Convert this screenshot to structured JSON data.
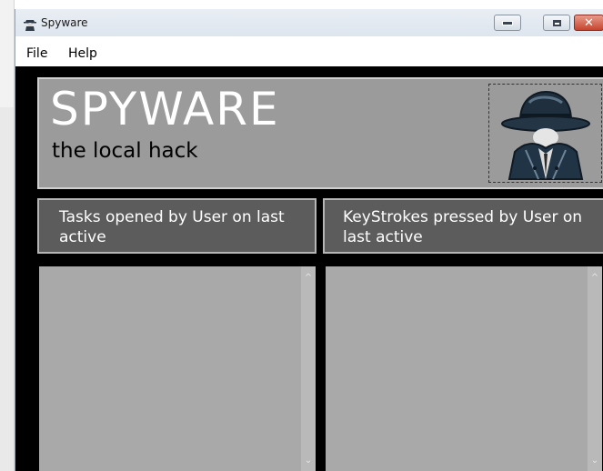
{
  "window": {
    "title": "Spyware",
    "close_glyph": "✕"
  },
  "menu": {
    "items": [
      {
        "label": "File"
      },
      {
        "label": "Help"
      }
    ]
  },
  "banner": {
    "title": "SPYWARE",
    "subtitle": "the local hack",
    "logo_icon": "spy-agent-icon"
  },
  "sections": {
    "tasks": {
      "header": "Tasks opened by User on last active"
    },
    "keystrokes": {
      "header": "KeyStrokes pressed by User on last active"
    }
  },
  "scrollbar": {
    "up_glyph": "^",
    "down_glyph": "⌄"
  },
  "colors": {
    "client_bg": "#000000",
    "banner_bg": "#9b9b9b",
    "header_bg": "#5c5c5c",
    "panel_bg": "#a9a9a9",
    "close_button": "#c5452f"
  }
}
